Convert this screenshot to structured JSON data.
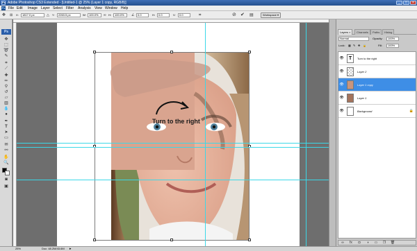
{
  "window": {
    "title": "Adobe Photoshop CS3 Extended - [Untitled-1 @ 25% (Layer 1 copy, RGB/8)]",
    "app_icon": "Ps"
  },
  "menu": {
    "logo": "Ps",
    "items": [
      "File",
      "Edit",
      "Image",
      "Layer",
      "Select",
      "Filter",
      "Analysis",
      "View",
      "Window",
      "Help"
    ]
  },
  "options_bar": {
    "x_label": "X:",
    "x_value": "1817.0 px",
    "y_label": "Y:",
    "y_value": "2263.5 px",
    "w_label": "W:",
    "w_value": "100.0%",
    "h_label": "H:",
    "h_value": "100.0%",
    "angle_value": "0.0",
    "hskew_label": "H:",
    "hskew_value": "0.0",
    "vskew_label": "V:",
    "vskew_value": "0.0",
    "workspace_label": "Workspace ▾"
  },
  "toolbar": {
    "logo": "Ps",
    "tools": [
      "move-tool",
      "marquee-tool",
      "lasso-tool",
      "quick-select-tool",
      "crop-tool",
      "slice-tool",
      "healing-tool",
      "brush-tool",
      "clone-stamp-tool",
      "history-brush-tool",
      "eraser-tool",
      "gradient-tool",
      "blur-tool",
      "dodge-tool",
      "pen-tool",
      "type-tool",
      "path-select-tool",
      "shape-tool",
      "notes-tool",
      "eyedropper-tool",
      "hand-tool",
      "zoom-tool"
    ]
  },
  "canvas": {
    "annotation_text": "Turn to the right",
    "zoom": "25%"
  },
  "status": {
    "zoom": "25%",
    "doc": "Doc: 48.2M/43.6M"
  },
  "layers_panel": {
    "tabs": [
      "Layers ×",
      "Channels",
      "Paths",
      "Histog"
    ],
    "blend_mode": "Normal",
    "opacity_label": "Opacity:",
    "opacity_value": "100%",
    "lock_label": "Lock:",
    "fill_label": "Fill:",
    "fill_value": "100%",
    "layers": [
      {
        "name": "Turn to the right",
        "type": "text"
      },
      {
        "name": "Layer 2",
        "type": "pixel"
      },
      {
        "name": "Layer 1 copy",
        "type": "pixel",
        "selected": true
      },
      {
        "name": "Layer 1",
        "type": "pixel"
      },
      {
        "name": "Background",
        "type": "background"
      }
    ]
  },
  "colors": {
    "accent": "#3e8ee6",
    "guide": "#3ad8e8",
    "title_bar": "#2f5fa5"
  }
}
